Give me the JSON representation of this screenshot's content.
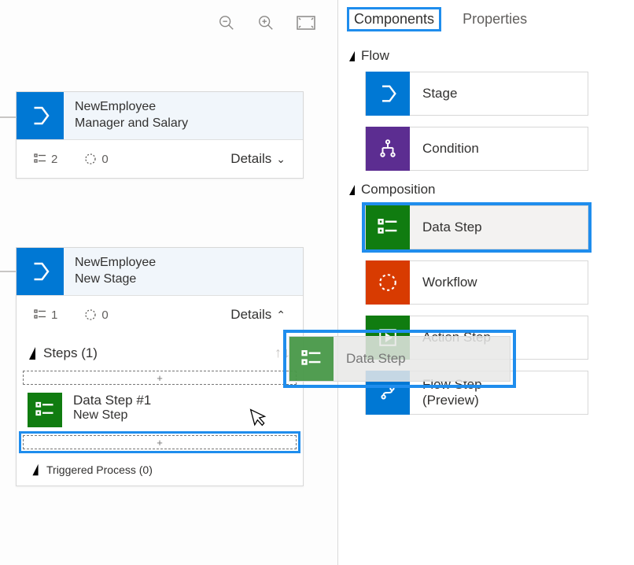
{
  "canvas": {
    "toolbar": {
      "zoom_out": "zoom-out",
      "zoom_in": "zoom-in",
      "fit": "fit-screen"
    },
    "stages": [
      {
        "entity": "NewEmployee",
        "name": "Manager and Salary",
        "steps_count": "2",
        "triggers_count": "0",
        "details_label": "Details",
        "expanded": false
      },
      {
        "entity": "NewEmployee",
        "name": "New Stage",
        "steps_count": "1",
        "triggers_count": "0",
        "details_label": "Details",
        "expanded": true,
        "steps_header": "Steps (1)",
        "step": {
          "title": "Data Step #1",
          "sub": "New Step"
        },
        "dropzone_plus": "+",
        "triggered_header": "Triggered Process (0)"
      }
    ]
  },
  "panel": {
    "tabs": {
      "components": "Components",
      "properties": "Properties"
    },
    "groups": {
      "flow": {
        "label": "Flow",
        "items": {
          "stage": "Stage",
          "condition": "Condition"
        }
      },
      "composition": {
        "label": "Composition",
        "items": {
          "data_step": "Data Step",
          "workflow": "Workflow",
          "action_step": "Action Step",
          "flow_step": "Flow Step\n(Preview)"
        }
      }
    }
  },
  "drag_ghost": {
    "label": "Data Step"
  }
}
